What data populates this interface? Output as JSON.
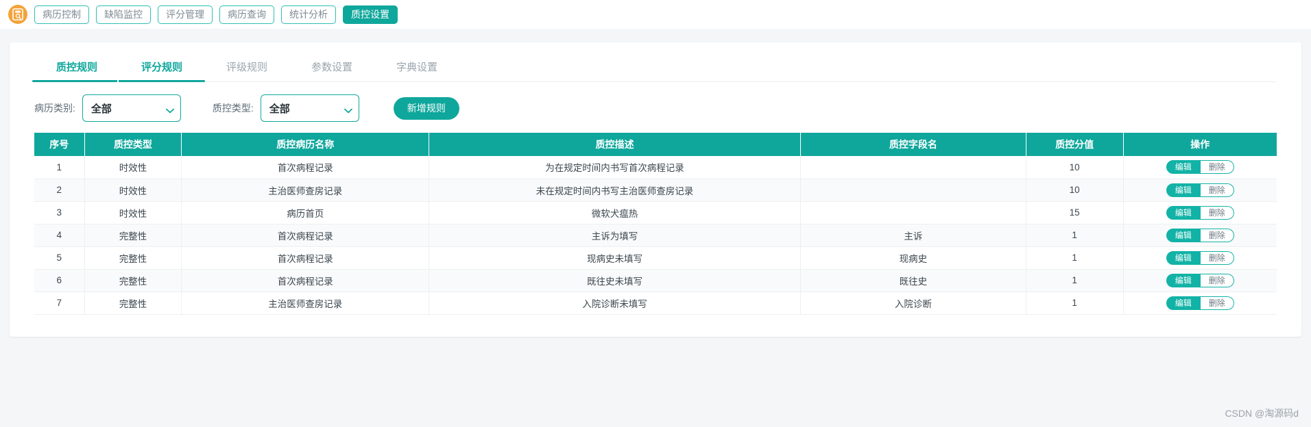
{
  "topbar": {
    "logo_icon": "document-medical-icon",
    "nav_items": [
      {
        "label": "病历控制",
        "active": false
      },
      {
        "label": "缺陷监控",
        "active": false
      },
      {
        "label": "评分管理",
        "active": false
      },
      {
        "label": "病历查询",
        "active": false
      },
      {
        "label": "统计分析",
        "active": false
      },
      {
        "label": "质控设置",
        "active": true
      }
    ]
  },
  "subtabs": [
    {
      "label": "质控规则",
      "state": "teal"
    },
    {
      "label": "评分规则",
      "state": "active"
    },
    {
      "label": "评级规则",
      "state": "normal"
    },
    {
      "label": "参数设置",
      "state": "normal"
    },
    {
      "label": "字典设置",
      "state": "normal"
    }
  ],
  "filters": {
    "case_type": {
      "label": "病历类别:",
      "value": "全部",
      "options": [
        "全部"
      ]
    },
    "qc_type": {
      "label": "质控类型:",
      "value": "全部",
      "options": [
        "全部"
      ]
    },
    "add_button": "新增规则",
    "caret_icon": "chevron-down-icon"
  },
  "table": {
    "headers": [
      "序号",
      "质控类型",
      "质控病历名称",
      "质控描述",
      "质控字段名",
      "质控分值",
      "操作"
    ],
    "actions": {
      "edit": "编辑",
      "delete": "删除"
    },
    "rows": [
      {
        "idx": "1",
        "type": "时效性",
        "name": "首次病程记录",
        "desc": "为在规定时间内书写首次病程记录",
        "field": "",
        "score": "10"
      },
      {
        "idx": "2",
        "type": "时效性",
        "name": "主治医师查房记录",
        "desc": "未在规定时间内书写主治医师查房记录",
        "field": "",
        "score": "10"
      },
      {
        "idx": "3",
        "type": "时效性",
        "name": "病历首页",
        "desc": "微软犬瘟热",
        "field": "",
        "score": "15"
      },
      {
        "idx": "4",
        "type": "完整性",
        "name": "首次病程记录",
        "desc": "主诉为填写",
        "field": "主诉",
        "score": "1"
      },
      {
        "idx": "5",
        "type": "完整性",
        "name": "首次病程记录",
        "desc": "现病史未填写",
        "field": "现病史",
        "score": "1"
      },
      {
        "idx": "6",
        "type": "完整性",
        "name": "首次病程记录",
        "desc": "既往史未填写",
        "field": "既往史",
        "score": "1"
      },
      {
        "idx": "7",
        "type": "完整性",
        "name": "主治医师查房记录",
        "desc": "入院诊断未填写",
        "field": "入院诊断",
        "score": "1"
      }
    ]
  },
  "watermark": "CSDN @淘源码d",
  "colors": {
    "accent": "#0fa79c",
    "accent_light": "#12b3a6",
    "logo": "#f3a33b",
    "muted_text": "#9aa5ad",
    "page_bg": "#f5f6f8"
  }
}
